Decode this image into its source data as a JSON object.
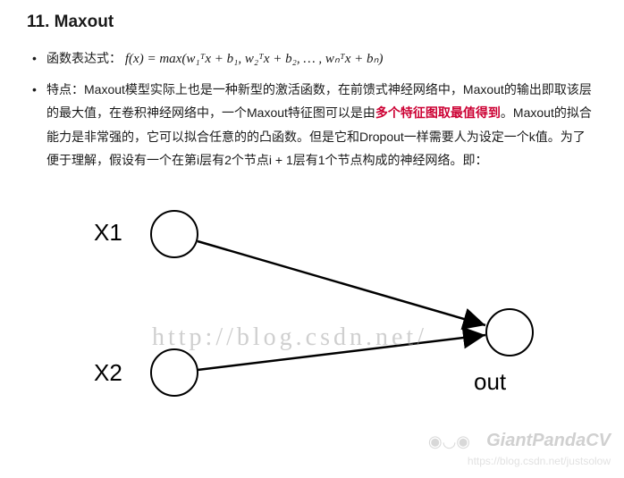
{
  "heading": "11. Maxout",
  "bullets": {
    "formula_label": "函数表达式：",
    "formula": "f(x) = max(w₁ᵀx + b₁, w₂ᵀx + b₂, … , wₙᵀx + bₙ)",
    "features_prefix": "特点：Maxout模型实际上也是一种新型的激活函数，在前馈式神经网络中，Maxout的输出即取该层的最大值，在卷积神经网络中，一个Maxout特征图可以是由",
    "features_highlight": "多个特征图取最值得到",
    "features_suffix": "。Maxout的拟合能力是非常强的，它可以拟合任意的的凸函数。但是它和Dropout一样需要人为设定一个k值。为了便于理解，假设有一个在第i层有2个节点i + 1层有1个节点构成的神经网络。即："
  },
  "diagram": {
    "x1": "X1",
    "x2": "X2",
    "out": "out"
  },
  "watermarks": {
    "url": "http://blog.csdn.net/",
    "brand": "GiantPandaCV",
    "subtext": "https://blog.csdn.net/justsolow"
  }
}
